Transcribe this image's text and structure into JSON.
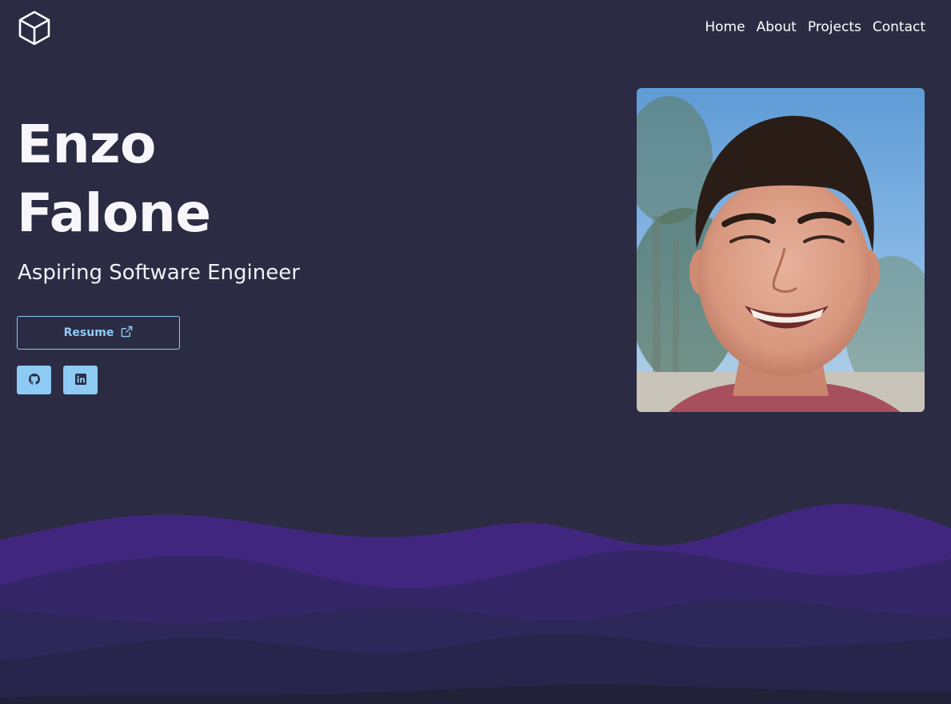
{
  "nav": {
    "logo_icon": "cube-icon",
    "links": [
      {
        "label": "Home"
      },
      {
        "label": "About"
      },
      {
        "label": "Projects"
      },
      {
        "label": "Contact"
      }
    ]
  },
  "hero": {
    "first_name": "Enzo",
    "last_name": "Falone",
    "subtitle": "Aspiring Software Engineer",
    "resume_label": "Resume",
    "resume_icon": "external-link-icon",
    "social": [
      {
        "icon": "github-icon"
      },
      {
        "icon": "linkedin-icon"
      }
    ],
    "photo": "profile-photo"
  },
  "colors": {
    "background": "#2b2c43",
    "accent": "#8ecbf4",
    "wave_1": "#41267f",
    "wave_2": "#352668",
    "wave_3": "#2e2759",
    "wave_4": "#28254c",
    "wave_5": "#222137"
  }
}
